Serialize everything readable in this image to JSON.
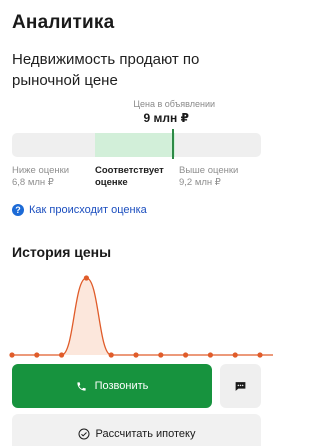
{
  "header": {
    "title": "Аналитика"
  },
  "assessment": {
    "subtitle": "Недвижимость продают по рыночной цене",
    "ad_price_caption": "Цена в объявлении",
    "ad_price": "9 млн ₽",
    "ranges": [
      {
        "label": "Ниже оценки",
        "value": "6,8 млн ₽"
      },
      {
        "label": "Соответствует оценке",
        "value": ""
      },
      {
        "label": "Выше оценки",
        "value": "9,2 млн ₽"
      }
    ],
    "how_link": "Как происходит оценка",
    "colors": {
      "in_range": "#d2efd9",
      "marker": "#2d8a46",
      "out_range": "#efefef"
    }
  },
  "history": {
    "title": "История цены",
    "series_color": "#e05c2a",
    "fill_color": "#fbe3d6",
    "points": [
      0,
      0,
      0,
      1,
      0,
      0,
      0,
      0,
      0,
      0,
      0,
      0,
      0,
      0
    ]
  },
  "actions": {
    "call_label": "Позвонить",
    "mortgage_label": "Рассчитать ипотеку",
    "call_color": "#17933e"
  }
}
